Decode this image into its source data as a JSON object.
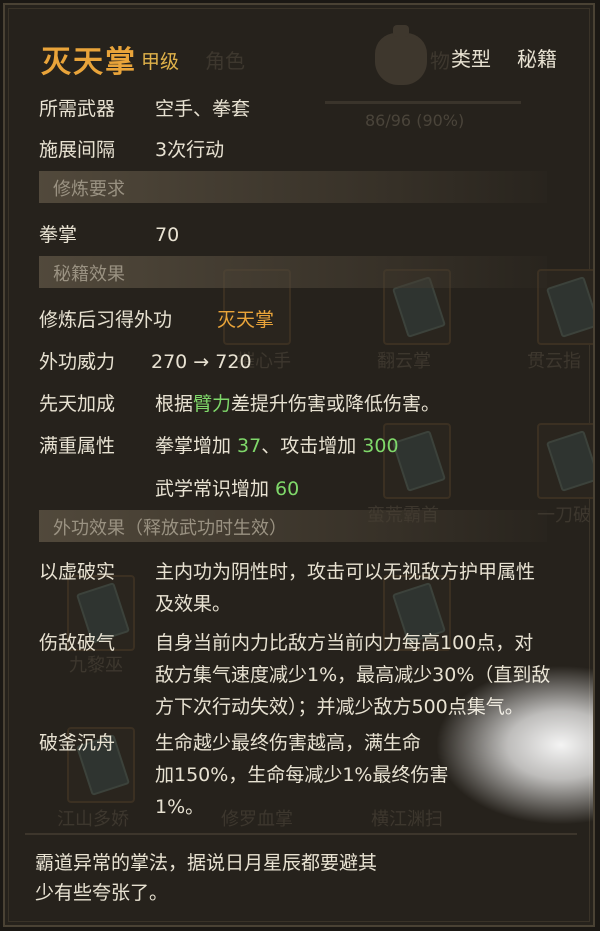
{
  "header": {
    "skill_name": "灭天掌",
    "grade": "甲级",
    "type_label": "类型",
    "type_value": "秘籍"
  },
  "background_ui": {
    "tab_role": "角色",
    "tab_items": "物",
    "capacity": "86/96 (90%)",
    "slot_labels": [
      "翻云掌",
      "摧心手",
      "贯云指",
      "蛮荒霸首",
      "一刀破",
      "九黎巫",
      "江山多娇",
      "修罗血掌",
      "横江渊扫"
    ]
  },
  "stats": {
    "weapon_label": "所需武器",
    "weapon_value": "空手、拳套",
    "interval_label": "施展间隔",
    "interval_value": "3次行动"
  },
  "requirements": {
    "section_title": "修炼要求",
    "skill_label": "拳掌",
    "skill_value": "70"
  },
  "effects": {
    "section_title": "秘籍效果",
    "learn_label": "修炼后习得外功",
    "learn_value": "灭天掌",
    "power_label": "外功威力",
    "power_value": "270 → 720",
    "innate_label": "先天加成",
    "innate_pre": "根据",
    "innate_attr": "臂力",
    "innate_post": "差提升伤害或降低伤害。",
    "full_label": "满重属性",
    "full_1_text": "拳掌增加 ",
    "full_1_value": "37",
    "full_2_text": "、攻击增加 ",
    "full_2_value": "300",
    "full_3_text": "武学常识增加 ",
    "full_3_value": "60"
  },
  "external": {
    "section_title": "外功效果（释放武功时生效）",
    "e1_label": "以虚破实",
    "e1_line1": "主内功为阴性时，攻击可以无视敌方护甲属性",
    "e1_line2": "及效果。",
    "e2_label": "伤敌破气",
    "e2_line1": "自身当前内力比敌方当前内力每高100点，对",
    "e2_line2": "敌方集气速度减少1%，最高减少30%（直到敌",
    "e2_line3": "方下次行动失效）；并减少敌方500点集气。",
    "e3_label": "破釜沉舟",
    "e3_line1": "生命越少最终伤害越高，满生命",
    "e3_line2": "加150%，生命每减少1%最终伤害",
    "e3_line3": "1%。"
  },
  "description": {
    "line1": "霸道异常的掌法，据说日月星辰都要避其",
    "line2": "少有些夸张了。"
  },
  "colors": {
    "title": "#e9a43a",
    "highlight_green": "#7fd86a",
    "text": "#e8e2d2",
    "section_text": "#9a9282",
    "panel_bg": "#26221c"
  }
}
